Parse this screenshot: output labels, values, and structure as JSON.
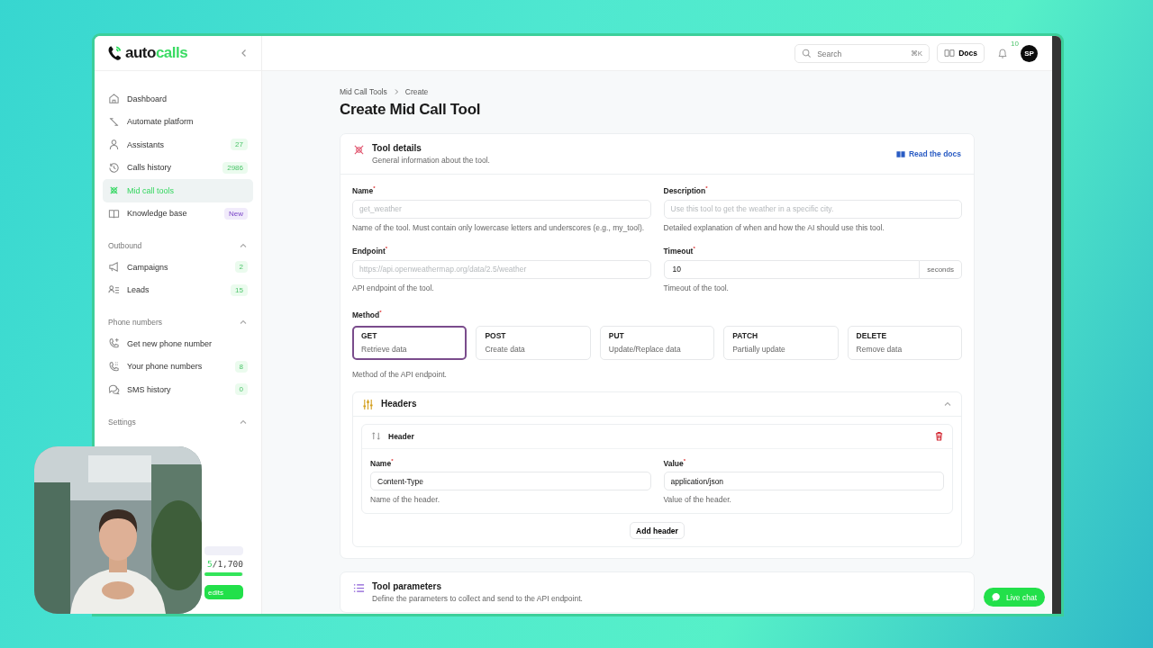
{
  "logo": {
    "part1": "auto",
    "part2": "calls"
  },
  "sidebar": {
    "items": [
      {
        "label": "Dashboard",
        "selected": false
      },
      {
        "label": "Automate platform",
        "selected": false
      },
      {
        "label": "Assistants",
        "badge": "27",
        "kind": "count",
        "selected": false
      },
      {
        "label": "Calls history",
        "badge": "2986",
        "kind": "count",
        "selected": false
      },
      {
        "label": "Mid call tools",
        "selected": true
      },
      {
        "label": "Knowledge base",
        "badge": "New",
        "kind": "new",
        "selected": false
      }
    ],
    "sections": [
      {
        "title": "Outbound",
        "expanded": true,
        "items": [
          {
            "label": "Campaigns",
            "badge": "2",
            "kind": "count",
            "selected": false
          },
          {
            "label": "Leads",
            "badge": "15",
            "kind": "count",
            "selected": false
          }
        ]
      },
      {
        "title": "Phone numbers",
        "expanded": true,
        "items": [
          {
            "label": "Get new phone number",
            "selected": false
          },
          {
            "label": "Your phone numbers",
            "badge": "8",
            "kind": "count",
            "selected": false
          },
          {
            "label": "SMS history",
            "badge": "0",
            "kind": "count",
            "selected": false
          }
        ]
      },
      {
        "title": "Settings",
        "expanded": true
      }
    ],
    "credits": {
      "used": "5",
      "total": "/1,700",
      "level": 0.98,
      "button": "edits"
    }
  },
  "topbar": {
    "search_placeholder": "Search",
    "shortcut": "⌘K",
    "docs": "Docs",
    "notifications": "10",
    "avatar": "SP"
  },
  "breadcrumb": [
    "Mid Call Tools",
    "Create"
  ],
  "title": "Create Mid Call Tool",
  "tool_details": {
    "title": "Tool details",
    "subtitle": "General information about the tool.",
    "docs_link": "Read the docs",
    "fields": [
      {
        "label": "Name$^{*}$",
        "placeholder": "get_weather",
        "help": "Name of the tool. Must contain only lowercase letters and underscores (e.g., my_tool)."
      },
      {
        "label": "Description$^{*}$",
        "placeholder": "Use this tool to get the weather in a specific city.",
        "help": "Detailed explanation of when and how the AI should use this tool."
      },
      {
        "label": "Endpoint$^{*}$",
        "placeholder": "https://api.openweathermap.org/data/2.5/weather",
        "help": "API endpoint of the tool."
      },
      {
        "label": "Timeout$^{*}$",
        "value": "10",
        "suffix": "seconds",
        "help": "Timeout of the tool."
      }
    ],
    "method": {
      "label": "Method$^{*}$",
      "help": "Method of the API endpoint.",
      "options": [
        {
          "name": "GET",
          "desc": "Retrieve data",
          "selected": true
        },
        {
          "name": "POST",
          "desc": "Create data",
          "selected": false
        },
        {
          "name": "PUT",
          "desc": "Update/Replace data",
          "selected": false
        },
        {
          "name": "PATCH",
          "desc": "Partially update",
          "selected": false
        },
        {
          "name": "DELETE",
          "desc": "Remove data",
          "selected": false
        }
      ]
    },
    "headers": {
      "title": "Headers",
      "expanded": true,
      "items": [
        {
          "title": "Header",
          "fields": [
            {
              "label": "Name$^{*}$",
              "value": "Content-Type",
              "help": "Name of the header."
            },
            {
              "label": "Value$^{*}$",
              "value": "application/json",
              "help": "Value of the header."
            }
          ]
        }
      ],
      "add_button": "Add header"
    }
  },
  "tool_parameters": {
    "title": "Tool parameters",
    "subtitle": "Define the parameters to collect and send to the API endpoint."
  },
  "live_chat": "Live chat"
}
